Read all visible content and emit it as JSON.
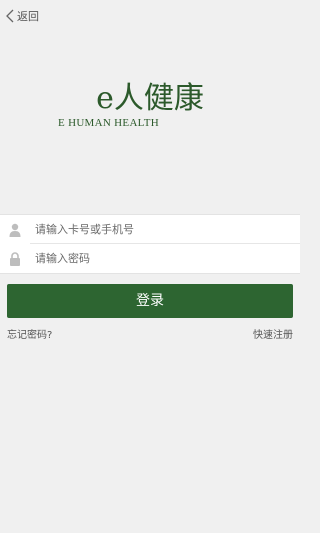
{
  "topbar": {
    "back_label": "返回",
    "back_icon": "chevron-left-icon"
  },
  "logo": {
    "main": "e人健康",
    "sub": "E HUMAN HEALTH"
  },
  "form": {
    "account": {
      "placeholder": "请输入卡号或手机号",
      "icon": "user-icon"
    },
    "password": {
      "placeholder": "请输入密码",
      "icon": "lock-icon"
    }
  },
  "login_label": "登录",
  "forgot_label": "忘记密码?",
  "register_label": "快速注册",
  "colors": {
    "brand": "#2d6531",
    "background": "#f0f0f0"
  }
}
